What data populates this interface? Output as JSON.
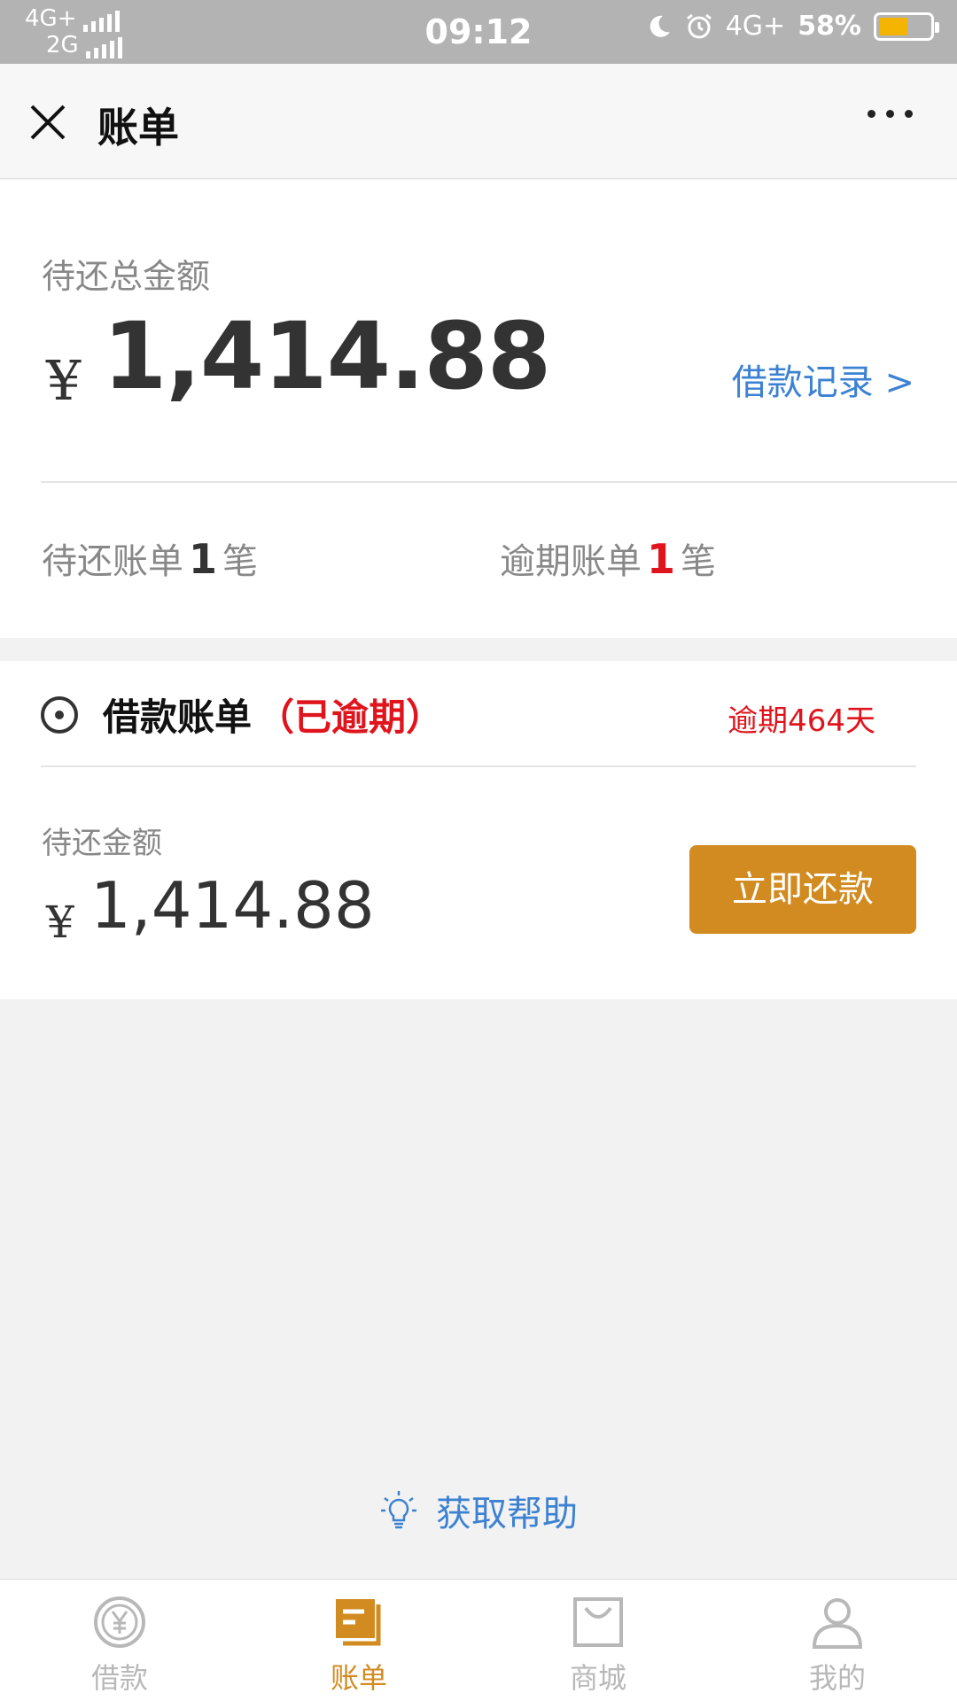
{
  "status_bar": {
    "network1": "4G+",
    "network2": "2G",
    "time": "09:12",
    "network3": "4G+",
    "battery": "58%",
    "battery_level": 0.58
  },
  "header": {
    "title": "账单"
  },
  "summary": {
    "label": "待还总金额",
    "currency": "¥",
    "amount": "1,414.88",
    "record_link": "借款记录 >",
    "pending_prefix": "待还账单",
    "pending_count": "1",
    "pending_suffix": "笔",
    "overdue_prefix": "逾期账单",
    "overdue_count": "1",
    "overdue_suffix": "笔"
  },
  "bill": {
    "title": "借款账单",
    "status": "（已逾期）",
    "overdue_days": "逾期464天",
    "label": "待还金额",
    "currency": "¥",
    "amount": "1,414.88",
    "pay_button": "立即还款"
  },
  "help": {
    "label": "获取帮助"
  },
  "tabs": [
    {
      "label": "借款",
      "icon": "yen-circle-icon",
      "active": false
    },
    {
      "label": "账单",
      "icon": "bill-icon",
      "active": true
    },
    {
      "label": "商城",
      "icon": "shop-bag-icon",
      "active": false
    },
    {
      "label": "我的",
      "icon": "user-icon",
      "active": false
    }
  ],
  "colors": {
    "accent": "#d18b20",
    "link": "#3d82d2",
    "danger": "#e0141c",
    "battery": "#f5b400"
  }
}
